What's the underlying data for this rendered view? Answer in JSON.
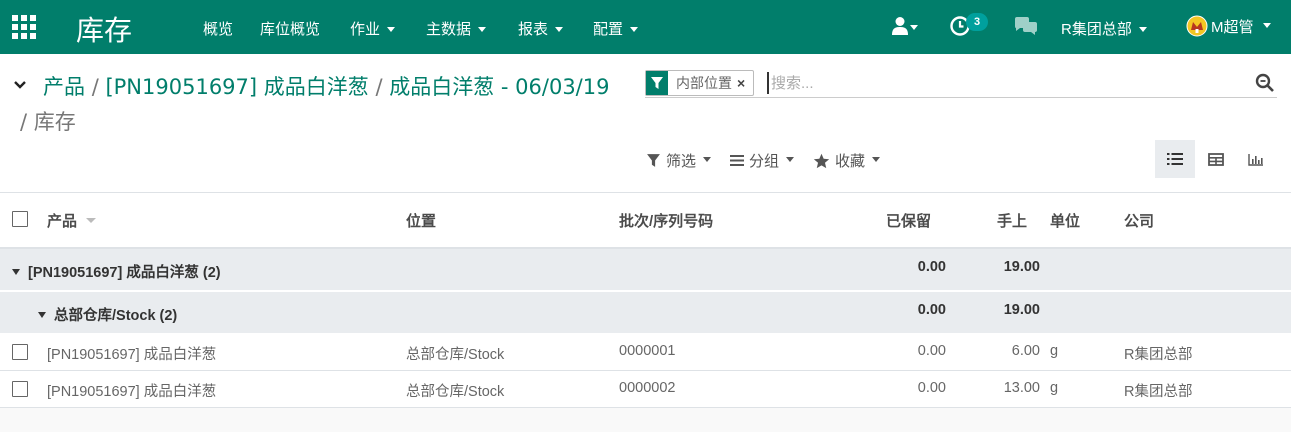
{
  "navbar": {
    "app_title": "库存",
    "menus": [
      "概览",
      "库位概览",
      "作业",
      "主数据",
      "报表",
      "配置"
    ],
    "activity_count": "3",
    "company": "R集团总部",
    "user": "M超管"
  },
  "breadcrumb": {
    "items": [
      "产品",
      "[PN19051697] 成品白洋葱",
      "成品白洋葱 - 06/03/19"
    ],
    "active": "库存",
    "separator": "/"
  },
  "search": {
    "facet_value": "内部位置",
    "facet_remove": "×",
    "placeholder": "搜索..."
  },
  "controls": {
    "filters": "筛选",
    "group_by": "分组",
    "favorites": "收藏"
  },
  "table": {
    "headers": {
      "product": "产品",
      "location": "位置",
      "lot": "批次/序列号码",
      "reserved": "已保留",
      "on_hand": "手上",
      "uom": "单位",
      "company": "公司"
    },
    "groups": [
      {
        "label": "[PN19051697] 成品白洋葱 (2)",
        "reserved": "0.00",
        "on_hand": "19.00"
      },
      {
        "label": "总部仓库/Stock (2)",
        "reserved": "0.00",
        "on_hand": "19.00"
      }
    ],
    "rows": [
      {
        "product": "[PN19051697] 成品白洋葱",
        "location": "总部仓库/Stock",
        "lot": "0000001",
        "reserved": "0.00",
        "on_hand": "6.00",
        "uom": "g",
        "company": "R集团总部"
      },
      {
        "product": "[PN19051697] 成品白洋葱",
        "location": "总部仓库/Stock",
        "lot": "0000002",
        "reserved": "0.00",
        "on_hand": "13.00",
        "uom": "g",
        "company": "R集团总部"
      }
    ]
  },
  "colors": {
    "brand": "#017e6b",
    "badge": "#00a09d",
    "group_bg": "#e9ecef"
  },
  "icons": [
    "apps-grid-icon",
    "user-icon",
    "clock-icon",
    "chat-icon",
    "avatar-icon",
    "chevron-down-icon",
    "filter-icon",
    "search-icon",
    "list-view-icon",
    "pivot-view-icon",
    "graph-view-icon",
    "star-icon",
    "bars-icon"
  ]
}
